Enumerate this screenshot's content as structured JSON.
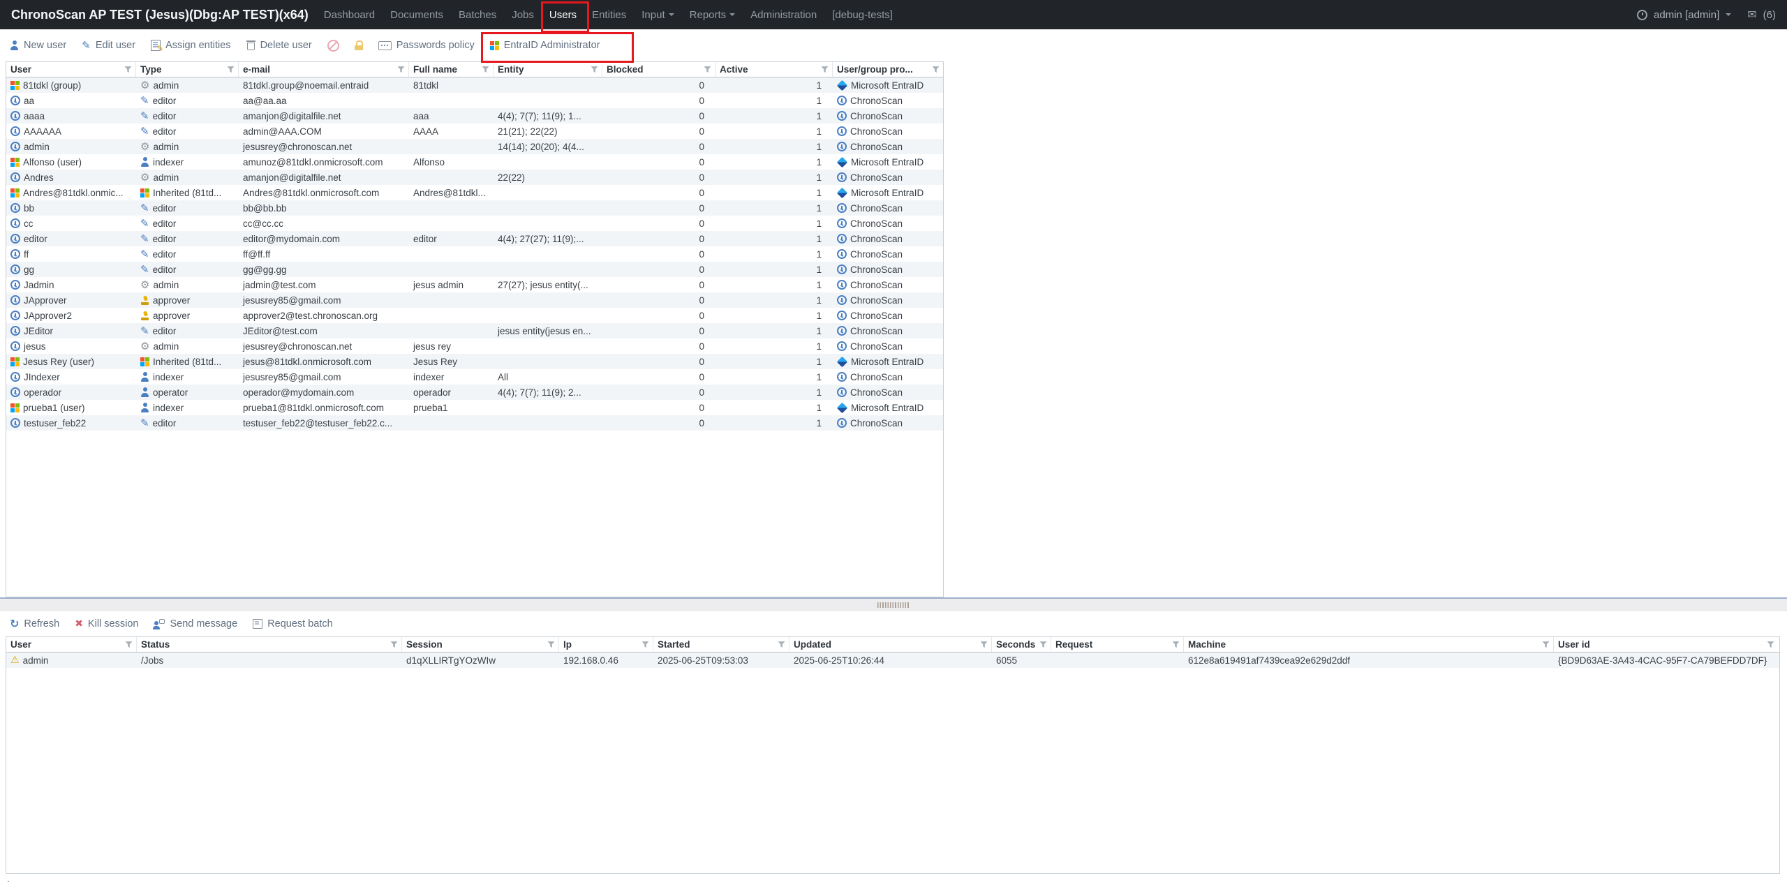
{
  "navbar": {
    "title": "ChronoScan AP TEST (Jesus)(Dbg:AP TEST)(x64)",
    "items": [
      {
        "label": "Dashboard",
        "active": false,
        "caret": false
      },
      {
        "label": "Documents",
        "active": false,
        "caret": false
      },
      {
        "label": "Batches",
        "active": false,
        "caret": false
      },
      {
        "label": "Jobs",
        "active": false,
        "caret": false
      },
      {
        "label": "Users",
        "active": true,
        "caret": false
      },
      {
        "label": "Entities",
        "active": false,
        "caret": false
      },
      {
        "label": "Input",
        "active": false,
        "caret": true
      },
      {
        "label": "Reports",
        "active": false,
        "caret": true
      },
      {
        "label": "Administration",
        "active": false,
        "caret": false
      },
      {
        "label": "[debug-tests]",
        "active": false,
        "caret": false
      }
    ],
    "user_menu_label": "admin [admin]",
    "mail_count": "(6)"
  },
  "users_toolbar": {
    "buttons": [
      {
        "id": "new-user-button",
        "label": "New user",
        "icon": "person-icon"
      },
      {
        "id": "edit-user-button",
        "label": "Edit user",
        "icon": "pencil-icon"
      },
      {
        "id": "assign-entities-button",
        "label": "Assign entities",
        "icon": "assign-entities-icon"
      },
      {
        "id": "delete-user-button",
        "label": "Delete user",
        "icon": "trash-icon"
      },
      {
        "id": "block-user-button",
        "label": "",
        "icon": "blocked-toggle-icon"
      },
      {
        "id": "lock-user-button",
        "label": "",
        "icon": "lock-icon"
      },
      {
        "id": "passwords-policy-button",
        "label": "Passwords policy",
        "icon": "password-icon"
      },
      {
        "id": "entraid-admin-button",
        "label": "EntraID Administrator",
        "icon": "ms-logo"
      }
    ]
  },
  "users_grid": {
    "columns": [
      {
        "label": "User"
      },
      {
        "label": "Type"
      },
      {
        "label": "e-mail"
      },
      {
        "label": "Full name"
      },
      {
        "label": "Entity"
      },
      {
        "label": "Blocked"
      },
      {
        "label": "Active"
      },
      {
        "label": "User/group pro..."
      }
    ],
    "rows": [
      {
        "user": "81tdkl (group)",
        "user_icon": "ms-logo",
        "type": "admin",
        "type_icon": "gear-icon",
        "email": "81tdkl.group@noemail.entraid",
        "full_name": "81tdkl",
        "entity": "",
        "blocked": "0",
        "active": "1",
        "provider": "Microsoft EntraID",
        "provider_icon": "entra-icon"
      },
      {
        "user": "aa",
        "user_icon": "chrono-icon",
        "type": "editor",
        "type_icon": "pencil-icon",
        "email": "aa@aa.aa",
        "full_name": "",
        "entity": "",
        "blocked": "0",
        "active": "1",
        "provider": "ChronoScan",
        "provider_icon": "chrono-icon"
      },
      {
        "user": "aaaa",
        "user_icon": "chrono-icon",
        "type": "editor",
        "type_icon": "pencil-icon",
        "email": "amanjon@digitalfile.net",
        "full_name": "aaa",
        "entity": "4(4); 7(7); 11(9); 1...",
        "blocked": "0",
        "active": "1",
        "provider": "ChronoScan",
        "provider_icon": "chrono-icon"
      },
      {
        "user": "AAAAAA",
        "user_icon": "chrono-icon",
        "type": "editor",
        "type_icon": "pencil-icon",
        "email": "admin@AAA.COM",
        "full_name": "AAAA",
        "entity": "21(21); 22(22)",
        "blocked": "0",
        "active": "1",
        "provider": "ChronoScan",
        "provider_icon": "chrono-icon"
      },
      {
        "user": "admin",
        "user_icon": "chrono-icon",
        "type": "admin",
        "type_icon": "gear-icon",
        "email": "jesusrey@chronoscan.net",
        "full_name": "",
        "entity": "14(14); 20(20); 4(4...",
        "blocked": "0",
        "active": "1",
        "provider": "ChronoScan",
        "provider_icon": "chrono-icon"
      },
      {
        "user": "Alfonso (user)",
        "user_icon": "ms-logo",
        "type": "indexer",
        "type_icon": "person-icon",
        "email": "amunoz@81tdkl.onmicrosoft.com",
        "full_name": "Alfonso",
        "entity": "",
        "blocked": "0",
        "active": "1",
        "provider": "Microsoft EntraID",
        "provider_icon": "entra-icon"
      },
      {
        "user": "Andres",
        "user_icon": "chrono-icon",
        "type": "admin",
        "type_icon": "gear-icon",
        "email": "amanjon@digitalfile.net",
        "full_name": "",
        "entity": "22(22)",
        "blocked": "0",
        "active": "1",
        "provider": "ChronoScan",
        "provider_icon": "chrono-icon"
      },
      {
        "user": "Andres@81tdkl.onmic...",
        "user_icon": "ms-logo",
        "type": "Inherited (81td...",
        "type_icon": "ms-logo",
        "email": "Andres@81tdkl.onmicrosoft.com",
        "full_name": "Andres@81tdkl...",
        "entity": "",
        "blocked": "0",
        "active": "1",
        "provider": "Microsoft EntraID",
        "provider_icon": "entra-icon"
      },
      {
        "user": "bb",
        "user_icon": "chrono-icon",
        "type": "editor",
        "type_icon": "pencil-icon",
        "email": "bb@bb.bb",
        "full_name": "",
        "entity": "",
        "blocked": "0",
        "active": "1",
        "provider": "ChronoScan",
        "provider_icon": "chrono-icon"
      },
      {
        "user": "cc",
        "user_icon": "chrono-icon",
        "type": "editor",
        "type_icon": "pencil-icon",
        "email": "cc@cc.cc",
        "full_name": "",
        "entity": "",
        "blocked": "0",
        "active": "1",
        "provider": "ChronoScan",
        "provider_icon": "chrono-icon"
      },
      {
        "user": "editor",
        "user_icon": "chrono-icon",
        "type": "editor",
        "type_icon": "pencil-icon",
        "email": "editor@mydomain.com",
        "full_name": "editor",
        "entity": "4(4); 27(27); 11(9);...",
        "blocked": "0",
        "active": "1",
        "provider": "ChronoScan",
        "provider_icon": "chrono-icon"
      },
      {
        "user": "ff",
        "user_icon": "chrono-icon",
        "type": "editor",
        "type_icon": "pencil-icon",
        "email": "ff@ff.ff",
        "full_name": "",
        "entity": "",
        "blocked": "0",
        "active": "1",
        "provider": "ChronoScan",
        "provider_icon": "chrono-icon"
      },
      {
        "user": "gg",
        "user_icon": "chrono-icon",
        "type": "editor",
        "type_icon": "pencil-icon",
        "email": "gg@gg.gg",
        "full_name": "",
        "entity": "",
        "blocked": "0",
        "active": "1",
        "provider": "ChronoScan",
        "provider_icon": "chrono-icon"
      },
      {
        "user": "Jadmin",
        "user_icon": "chrono-icon",
        "type": "admin",
        "type_icon": "gear-icon",
        "email": "jadmin@test.com",
        "full_name": "jesus admin",
        "entity": "27(27); jesus entity(...",
        "blocked": "0",
        "active": "1",
        "provider": "ChronoScan",
        "provider_icon": "chrono-icon"
      },
      {
        "user": "JApprover",
        "user_icon": "chrono-icon",
        "type": "approver",
        "type_icon": "stamp-icon",
        "email": "jesusrey85@gmail.com",
        "full_name": "",
        "entity": "",
        "blocked": "0",
        "active": "1",
        "provider": "ChronoScan",
        "provider_icon": "chrono-icon"
      },
      {
        "user": "JApprover2",
        "user_icon": "chrono-icon",
        "type": "approver",
        "type_icon": "stamp-icon",
        "email": "approver2@test.chronoscan.org",
        "full_name": "",
        "entity": "",
        "blocked": "0",
        "active": "1",
        "provider": "ChronoScan",
        "provider_icon": "chrono-icon"
      },
      {
        "user": "JEditor",
        "user_icon": "chrono-icon",
        "type": "editor",
        "type_icon": "pencil-icon",
        "email": "JEditor@test.com",
        "full_name": "",
        "entity": "jesus entity(jesus en...",
        "blocked": "0",
        "active": "1",
        "provider": "ChronoScan",
        "provider_icon": "chrono-icon"
      },
      {
        "user": "jesus",
        "user_icon": "chrono-icon",
        "type": "admin",
        "type_icon": "gear-icon",
        "email": "jesusrey@chronoscan.net",
        "full_name": "jesus rey",
        "entity": "",
        "blocked": "0",
        "active": "1",
        "provider": "ChronoScan",
        "provider_icon": "chrono-icon"
      },
      {
        "user": "Jesus Rey (user)",
        "user_icon": "ms-logo",
        "type": "Inherited (81td...",
        "type_icon": "ms-logo",
        "email": "jesus@81tdkl.onmicrosoft.com",
        "full_name": "Jesus Rey",
        "entity": "",
        "blocked": "0",
        "active": "1",
        "provider": "Microsoft EntraID",
        "provider_icon": "entra-icon"
      },
      {
        "user": "JIndexer",
        "user_icon": "chrono-icon",
        "type": "indexer",
        "type_icon": "person-icon",
        "email": "jesusrey85@gmail.com",
        "full_name": "indexer",
        "entity": "All",
        "blocked": "0",
        "active": "1",
        "provider": "ChronoScan",
        "provider_icon": "chrono-icon"
      },
      {
        "user": "operador",
        "user_icon": "chrono-icon",
        "type": "operator",
        "type_icon": "person-icon",
        "email": "operador@mydomain.com",
        "full_name": "operador",
        "entity": "4(4); 7(7); 11(9); 2...",
        "blocked": "0",
        "active": "1",
        "provider": "ChronoScan",
        "provider_icon": "chrono-icon"
      },
      {
        "user": "prueba1 (user)",
        "user_icon": "ms-logo",
        "type": "indexer",
        "type_icon": "person-icon",
        "email": "prueba1@81tdkl.onmicrosoft.com",
        "full_name": "prueba1",
        "entity": "",
        "blocked": "0",
        "active": "1",
        "provider": "Microsoft EntraID",
        "provider_icon": "entra-icon"
      },
      {
        "user": "testuser_feb22",
        "user_icon": "chrono-icon",
        "type": "editor",
        "type_icon": "pencil-icon",
        "email": "testuser_feb22@testuser_feb22.c...",
        "full_name": "",
        "entity": "",
        "blocked": "0",
        "active": "1",
        "provider": "ChronoScan",
        "provider_icon": "chrono-icon"
      }
    ]
  },
  "sessions_toolbar": {
    "buttons": [
      {
        "id": "refresh-button",
        "label": "Refresh",
        "icon": "refresh-icon"
      },
      {
        "id": "kill-session-button",
        "label": "Kill session",
        "icon": "kill-icon"
      },
      {
        "id": "send-message-button",
        "label": "Send message",
        "icon": "send-message-icon"
      },
      {
        "id": "request-batch-button",
        "label": "Request batch",
        "icon": "request-batch-icon"
      }
    ]
  },
  "sessions_grid": {
    "columns": [
      {
        "label": "User"
      },
      {
        "label": "Status"
      },
      {
        "label": "Session"
      },
      {
        "label": "Ip"
      },
      {
        "label": "Started"
      },
      {
        "label": "Updated"
      },
      {
        "label": "Seconds"
      },
      {
        "label": "Request"
      },
      {
        "label": "Machine"
      },
      {
        "label": "User id"
      }
    ],
    "rows": [
      {
        "user": "admin",
        "user_icon": "warning-icon",
        "status": "/Jobs",
        "session": "d1qXLLIRTgYOzWIw",
        "ip": "192.168.0.46",
        "started": "2025-06-25T09:53:03",
        "updated": "2025-06-25T10:26:44",
        "seconds": "6055",
        "request": "",
        "machine": "612e8a619491af7439cea92e629d2ddf",
        "user_id": "{BD9D63AE-3A43-4CAC-95F7-CA79BEFDD7DF}"
      }
    ]
  },
  "annotations": {
    "color": "#e6181e",
    "highlighted": [
      "Users tab",
      "EntraID Administrator button"
    ]
  },
  "icon_glyphs": {
    "gear-icon": "⚙",
    "pencil-icon": "✎",
    "refresh-icon": "↻",
    "kill-icon": "✖",
    "warning-icon": "⚠",
    "envelope-icon": "✉"
  },
  "colors": {
    "navbar_bg": "#212529",
    "accent_blue": "#4a7fc1",
    "annotation_red": "#e6181e",
    "ms_logo": [
      "#f35325",
      "#81bc06",
      "#05a6f0",
      "#ffba08"
    ],
    "row_alt_bg": "#f2f5f8"
  },
  "footer": {
    "dot": "."
  }
}
